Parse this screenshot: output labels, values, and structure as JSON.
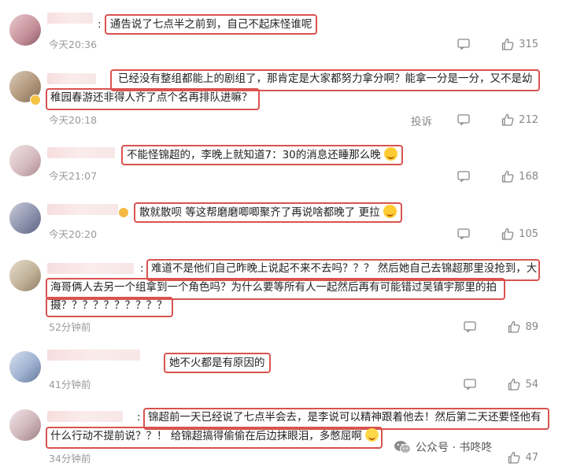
{
  "comments": [
    {
      "text": "通告说了七点半之前到，自己不起床怪谁呢",
      "time": "今天20:36",
      "likes": "315"
    },
    {
      "text_line1": "已经没有整组都能上的剧组了，那肯定是大家都努力拿分啊？能拿一分是一分，又不是幼",
      "text_line2": "稚园春游还非得人齐了点个名再排队进嘛？",
      "time": "今天20:18",
      "report": "投诉",
      "likes": "212"
    },
    {
      "text": "不能怪锦超的，李晚上就知道7：30的消息还睡那么晚",
      "time": "今天21:07",
      "likes": "168"
    },
    {
      "text": "散就散呗 等这帮磨磨唧唧聚齐了再说啥都晚了 更拉",
      "time": "今天20:20",
      "likes": "105"
    },
    {
      "text_line1": "难道不是他们自己昨晚上说起不来不去吗？？？ 然后她自己去锦超那里没抢到，大",
      "text_line2": "海哥俩人去另一个组拿到一个角色吗？为什么要等所有人一起然后再有可能错过吴镇宇那里的拍",
      "text_line3": "摄？？？？？？？？？？",
      "time": "52分钟前",
      "likes": "89"
    },
    {
      "text": "她不火都是有原因的",
      "time": "41分钟前",
      "likes": "54"
    },
    {
      "text_line1": "锦超前一天已经说了七点半会去，是李说可以精神跟着他去！然后第二天还要怪他有",
      "text_line2": "什么行动不提前说？？！ 给锦超搞得偷偷在后边抹眼泪，多憋屈啊",
      "time": "34分钟前",
      "likes": "47"
    }
  ],
  "watermark": {
    "text": "公众号 · 书咚咚"
  },
  "icons": {
    "reply": "comment-icon",
    "like": "thumbs-up-icon"
  },
  "colors": {
    "highlight": "#d9534f",
    "meta": "#9a9a9a"
  }
}
